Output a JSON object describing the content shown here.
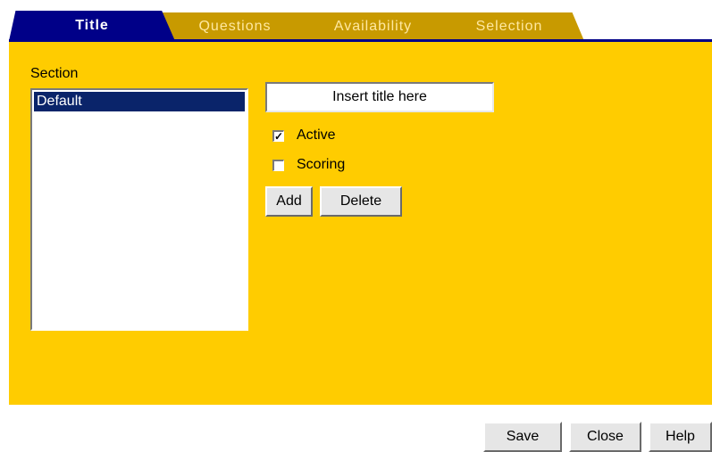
{
  "tabs": [
    {
      "label": "Title",
      "active": true
    },
    {
      "label": "Questions",
      "active": false
    },
    {
      "label": "Availability",
      "active": false
    },
    {
      "label": "Selection",
      "active": false
    }
  ],
  "section": {
    "label": "Section",
    "items": [
      "Default"
    ],
    "selected": "Default"
  },
  "title_field": {
    "value": "Insert title here"
  },
  "checkboxes": {
    "active": {
      "label": "Active",
      "checked": true,
      "mark": "✓"
    },
    "scoring": {
      "label": "Scoring",
      "checked": false
    }
  },
  "buttons": {
    "add": "Add",
    "delete": "Delete",
    "save": "Save",
    "close": "Close",
    "help": "Help"
  },
  "colors": {
    "panel": "#ffcc00",
    "active_tab": "#000088",
    "inactive_tab": "#c89a00",
    "selection": "#0a246a"
  }
}
